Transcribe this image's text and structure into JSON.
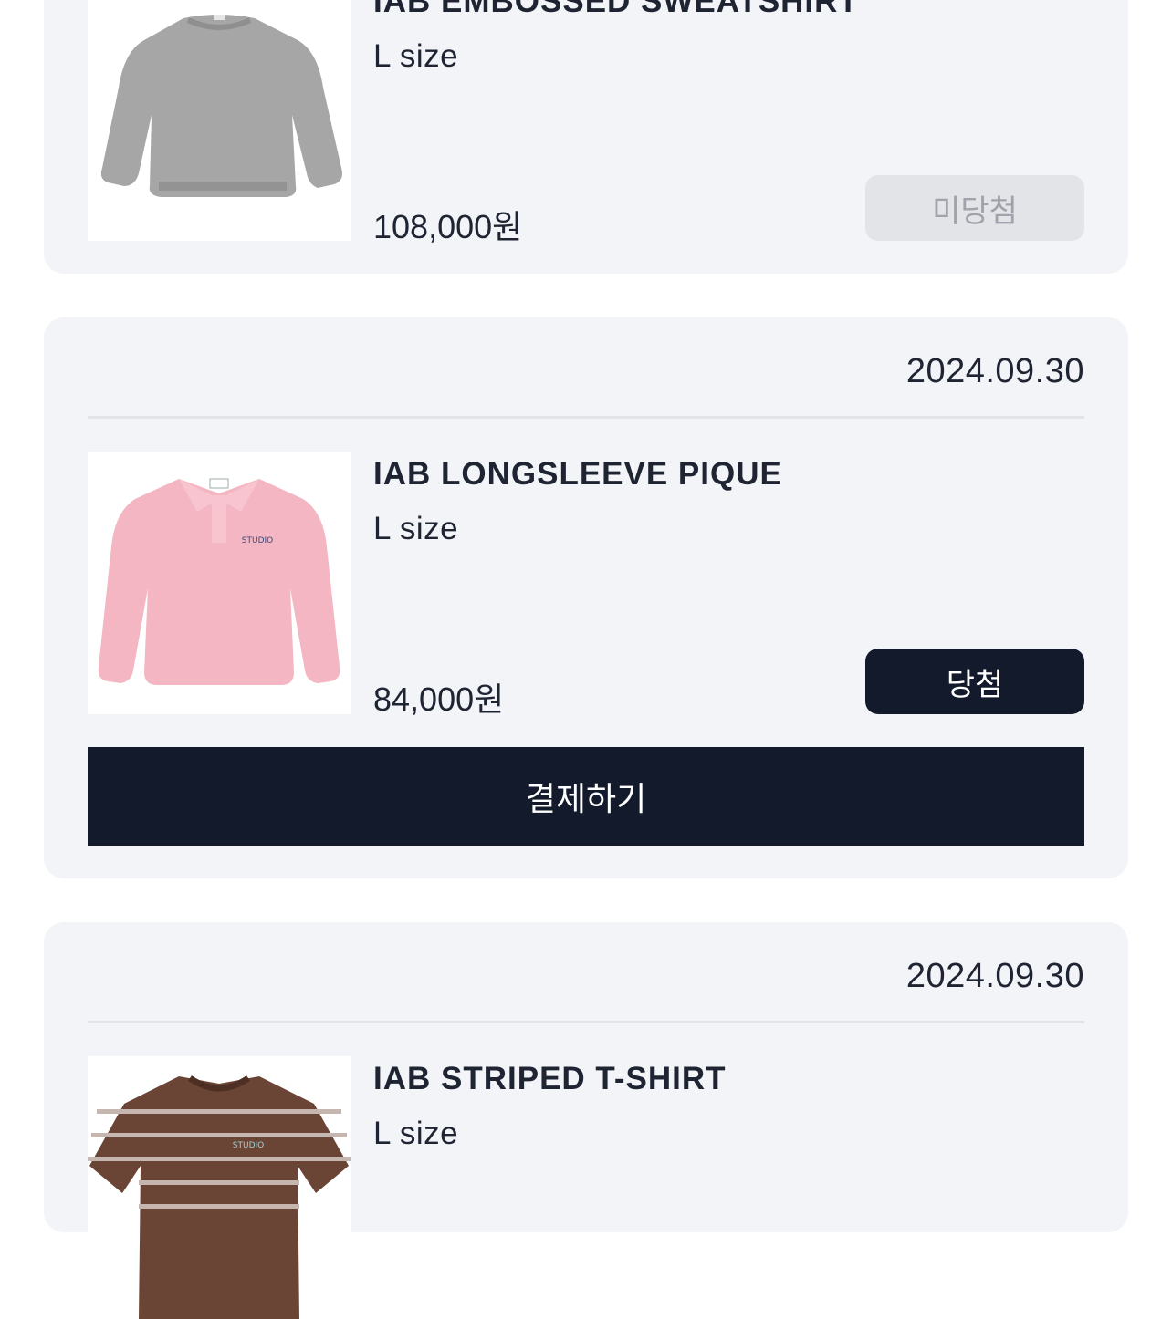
{
  "orders": [
    {
      "product_name": "IAB EMBOSSED SWEATSHIRT",
      "size": "L size",
      "price": "108,000원",
      "status": "미당첨",
      "image": "gray-sweatshirt"
    },
    {
      "date": "2024.09.30",
      "product_name": "IAB LONGSLEEVE PIQUE",
      "size": "L size",
      "price": "84,000원",
      "status": "당첨",
      "pay_label": "결제하기",
      "image": "pink-pique-shirt"
    },
    {
      "date": "2024.09.30",
      "product_name": "IAB STRIPED T-SHIRT",
      "size": "L size",
      "image": "brown-striped-tshirt"
    }
  ],
  "colors": {
    "card_bg": "#f3f4f7",
    "primary_dark": "#121a2b",
    "disabled_bg": "#e3e4e8",
    "disabled_text": "#a0a3ab"
  }
}
